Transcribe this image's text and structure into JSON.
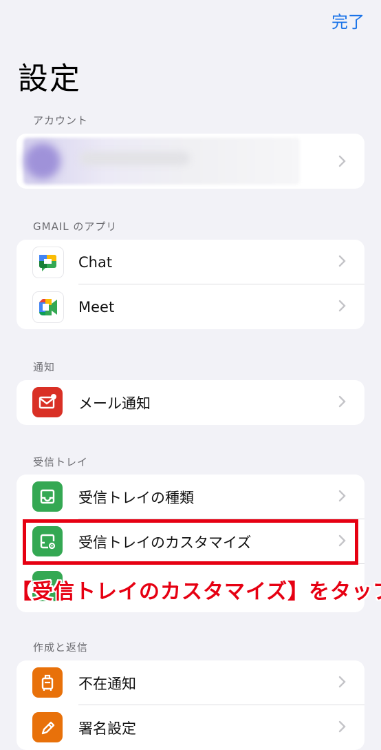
{
  "header": {
    "done_label": "完了",
    "title": "設定"
  },
  "sections": {
    "account": {
      "label": "アカウント"
    },
    "apps": {
      "label": "GMAIL のアプリ",
      "items": [
        {
          "label": "Chat",
          "icon": "google-chat-icon"
        },
        {
          "label": "Meet",
          "icon": "google-meet-icon"
        }
      ]
    },
    "notifications": {
      "label": "通知",
      "items": [
        {
          "label": "メール通知",
          "icon": "mail-notification-icon"
        }
      ]
    },
    "inbox": {
      "label": "受信トレイ",
      "items": [
        {
          "label": "受信トレイの種類",
          "icon": "inbox-icon"
        },
        {
          "label": "受信トレイのカスタマイズ",
          "icon": "inbox-settings-icon"
        }
      ]
    },
    "compose": {
      "label": "作成と返信",
      "items": [
        {
          "label": "不在通知",
          "icon": "suitcase-icon"
        },
        {
          "label": "署名設定",
          "icon": "pen-icon"
        }
      ]
    }
  },
  "annotation": {
    "callout": "【受信トレイのカスタマイズ】をタップ"
  },
  "colors": {
    "accent": "#1a73e8",
    "highlight": "#e60012",
    "green": "#34a853",
    "red": "#d93025",
    "orange": "#e8710a"
  }
}
